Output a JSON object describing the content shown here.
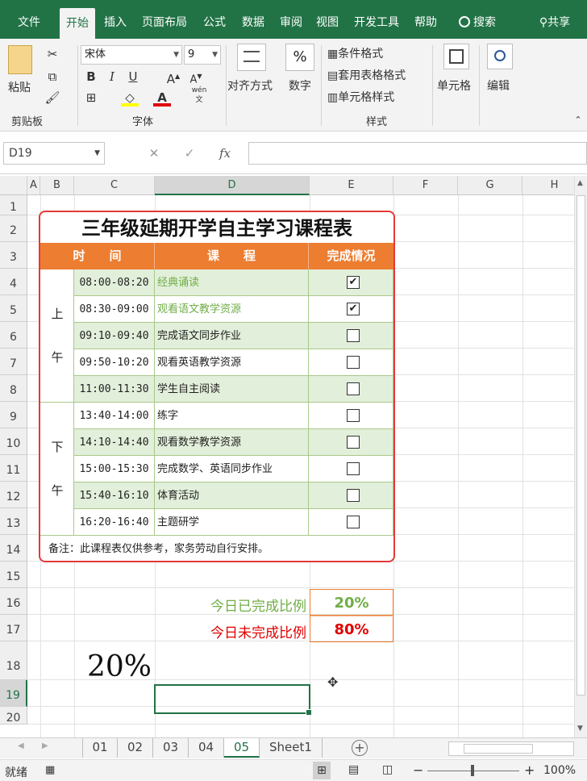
{
  "menu": {
    "items": [
      "文件",
      "开始",
      "插入",
      "页面布局",
      "公式",
      "数据",
      "审阅",
      "视图",
      "开发工具",
      "帮助"
    ],
    "search_label": "搜索",
    "share_label": "共享"
  },
  "ribbon": {
    "paste_label": "粘贴",
    "clipboard_label": "剪贴板",
    "font_name": "宋体",
    "font_size": "9",
    "bold": "B",
    "italic": "I",
    "underline": "U",
    "font_group_label": "字体",
    "align_label": "对齐方式",
    "number_label": "数字",
    "number_symbol": "%",
    "cond_format": "条件格式",
    "table_format": "套用表格格式",
    "cell_style": "单元格样式",
    "styles_label": "样式",
    "cells_label": "单元格",
    "edit_label": "编辑",
    "phonetic": "wén"
  },
  "formula_bar": {
    "name_box": "D19",
    "fx": "fx",
    "cancel": "✕",
    "confirm": "✓",
    "value": ""
  },
  "columns": [
    "A",
    "B",
    "C",
    "D",
    "E",
    "F",
    "G",
    "H"
  ],
  "rows": [
    "1",
    "2",
    "3",
    "4",
    "5",
    "6",
    "7",
    "8",
    "9",
    "10",
    "11",
    "12",
    "13",
    "14",
    "15",
    "16",
    "17",
    "18",
    "19",
    "20"
  ],
  "schedule": {
    "title": "三年级延期开学自主学习课程表",
    "headers": {
      "time": "时　　间",
      "course": "课　　程",
      "status": "完成情况"
    },
    "morning": [
      "上",
      "午"
    ],
    "afternoon": [
      "下",
      "午"
    ],
    "items": [
      {
        "time": "08:00-08:20",
        "task": "经典诵读",
        "checked": true
      },
      {
        "time": "08:30-09:00",
        "task": "观看语文教学资源",
        "checked": true
      },
      {
        "time": "09:10-09:40",
        "task": "完成语文同步作业",
        "checked": false
      },
      {
        "time": "09:50-10:20",
        "task": "观看英语教学资源",
        "checked": false
      },
      {
        "time": "11:00-11:30",
        "task": "学生自主阅读",
        "checked": false
      },
      {
        "time": "13:40-14:00",
        "task": "练字",
        "checked": false
      },
      {
        "time": "14:10-14:40",
        "task": "观看数学教学资源",
        "checked": false
      },
      {
        "time": "15:00-15:30",
        "task": "完成数学、英语同步作业",
        "checked": false
      },
      {
        "time": "15:40-16:10",
        "task": "体育活动",
        "checked": false
      },
      {
        "time": "16:20-16:40",
        "task": "主题研学",
        "checked": false
      }
    ],
    "note": "备注：此课程表仅供参考，家务劳动自行安排。"
  },
  "ratios": {
    "done_label": "今日已完成比例",
    "done_value": "20%",
    "todo_label": "今日未完成比例",
    "todo_value": "80%",
    "big_value": "20%",
    "done_color": "#70ad47",
    "todo_color": "#e00000"
  },
  "tabs": [
    "01",
    "02",
    "03",
    "04",
    "05",
    "Sheet1"
  ],
  "active_tab": "05",
  "status": {
    "ready": "就绪",
    "zoom": "100%",
    "minus": "−",
    "plus": "+"
  },
  "colors": {
    "accent": "#217346",
    "header_orange": "#ed7d31",
    "row_green": "#e2efda",
    "frame_red": "#e23a3a"
  }
}
